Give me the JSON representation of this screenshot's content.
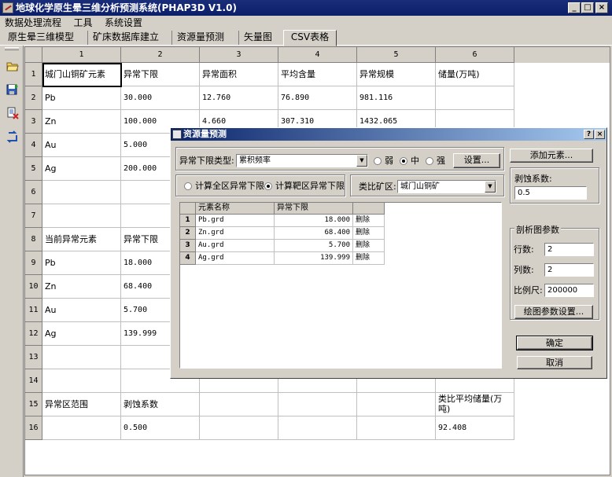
{
  "window": {
    "title": "地球化学原生晕三维分析预测系统(PHAP3D V1.0)"
  },
  "menu": [
    "数据处理流程",
    "工具",
    "系统设置"
  ],
  "tabs": [
    "原生晕三维模型",
    "矿床数据库建立",
    "资源量预测",
    "矢量图",
    "CSV表格"
  ],
  "active_tab": 4,
  "toolbar_icons": [
    "open-folder-icon",
    "save-icon",
    "delete-file-icon",
    "refresh-arrow-icon"
  ],
  "sheet": {
    "columns": [
      "1",
      "2",
      "3",
      "4",
      "5",
      "6"
    ],
    "rows": [
      {
        "n": "1",
        "cells": [
          "城门山铜矿元素",
          "异常下限",
          "异常面积",
          "平均含量",
          "异常规模",
          "储量(万吨)"
        ]
      },
      {
        "n": "2",
        "cells": [
          "Pb",
          "30.000",
          "12.760",
          "76.890",
          "981.116",
          ""
        ]
      },
      {
        "n": "3",
        "cells": [
          "Zn",
          "100.000",
          "4.660",
          "307.310",
          "1432.065",
          ""
        ]
      },
      {
        "n": "4",
        "cells": [
          "Au",
          "5.000",
          "",
          "",
          "",
          ""
        ]
      },
      {
        "n": "5",
        "cells": [
          "Ag",
          "200.000",
          "",
          "",
          "",
          ""
        ]
      },
      {
        "n": "6",
        "cells": [
          "",
          "",
          "",
          "",
          "",
          ""
        ]
      },
      {
        "n": "7",
        "cells": [
          "",
          "",
          "",
          "",
          "",
          ""
        ]
      },
      {
        "n": "8",
        "cells": [
          "当前异常元素",
          "异常下限",
          "",
          "",
          "",
          ""
        ]
      },
      {
        "n": "9",
        "cells": [
          "Pb",
          "18.000",
          "",
          "",
          "",
          ""
        ]
      },
      {
        "n": "10",
        "cells": [
          "Zn",
          "68.400",
          "",
          "",
          "",
          ""
        ]
      },
      {
        "n": "11",
        "cells": [
          "Au",
          "5.700",
          "",
          "",
          "",
          ""
        ]
      },
      {
        "n": "12",
        "cells": [
          "Ag",
          "139.999",
          "",
          "",
          "",
          ""
        ]
      },
      {
        "n": "13",
        "cells": [
          "",
          "",
          "",
          "",
          "",
          ""
        ]
      },
      {
        "n": "14",
        "cells": [
          "",
          "",
          "",
          "",
          "",
          ""
        ]
      },
      {
        "n": "15",
        "cells": [
          "异常区范围",
          "剥蚀系数",
          "",
          "",
          "",
          "类比平均储量(万吨)"
        ]
      },
      {
        "n": "16",
        "cells": [
          "",
          "0.500",
          "",
          "",
          "",
          "92.408"
        ]
      }
    ]
  },
  "dialog": {
    "title": "资源量预测",
    "threshold_type_label": "异常下限类型:",
    "threshold_type_value": "累积频率",
    "strength_options": [
      "弱",
      "中",
      "强"
    ],
    "strength_selected": 1,
    "settings_button": "设置...",
    "calc_options": [
      "计算全区异常下限",
      "计算靶区异常下限"
    ],
    "calc_selected": 1,
    "analog_label": "类比矿区:",
    "analog_value": "城门山铜矿",
    "table": {
      "headers": [
        "元素名称",
        "异常下限",
        ""
      ],
      "rows": [
        {
          "n": "1",
          "name": "Pb.grd",
          "value": "18.000",
          "action": "删除"
        },
        {
          "n": "2",
          "name": "Zn.grd",
          "value": "68.400",
          "action": "删除"
        },
        {
          "n": "3",
          "name": "Au.grd",
          "value": "5.700",
          "action": "删除"
        },
        {
          "n": "4",
          "name": "Ag.grd",
          "value": "139.999",
          "action": "删除"
        }
      ]
    },
    "add_element_button": "添加元素...",
    "erosion_label": "剥蚀系数:",
    "erosion_value": "0.5",
    "section_group_title": "剖析图参数",
    "rows_label": "行数:",
    "rows_value": "2",
    "cols_label": "列数:",
    "cols_value": "2",
    "scale_label": "比例尺:",
    "scale_value": "200000",
    "plot_params_button": "绘图参数设置...",
    "ok_button": "确定",
    "cancel_button": "取消"
  }
}
